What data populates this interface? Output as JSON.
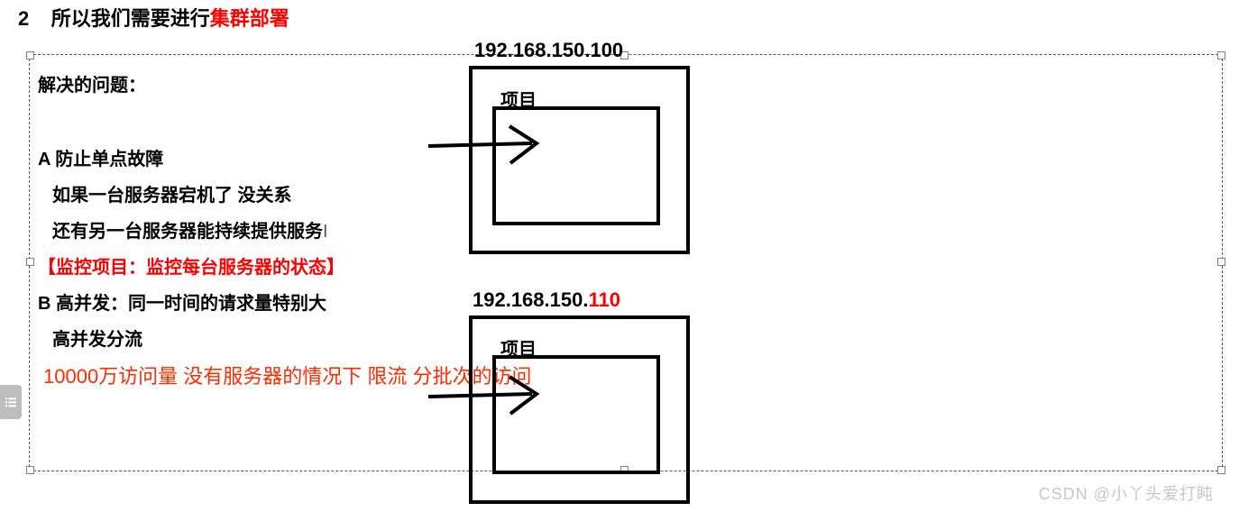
{
  "heading": {
    "num": "2",
    "black": "所以我们需要进行",
    "red": "集群部署"
  },
  "text": {
    "solve": "解决的问题：",
    "A": "A 防止单点故障",
    "A1": "如果一台服务器宕机了 没关系",
    "A2": "还有另一台服务器能持续提供服务",
    "monitor": "【监控项目：监控每台服务器的状态】",
    "B": "B 高并发：同一时间的请求量特别大",
    "B1": "高并发分流",
    "note": "10000万访问量 没有服务器的情况下 限流 分批次的访问"
  },
  "server1": {
    "ip": "192.168.150.100",
    "label": "项目"
  },
  "server2": {
    "ip_black": "192.168.150.",
    "ip_red": "110",
    "label": "项目"
  },
  "watermark": {
    "prefix": "CSDN ",
    "at": "@",
    "name": "小丫头爱打盹"
  }
}
